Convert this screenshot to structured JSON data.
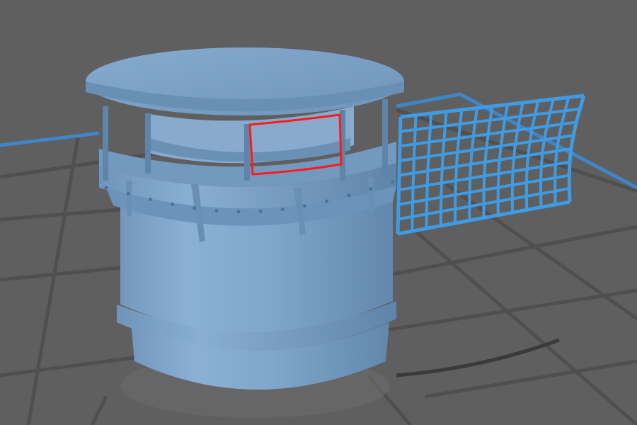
{
  "viewport": {
    "background": "#5f5f5f",
    "grid_color": "#4f4f4f",
    "axis_color": "#3f86c6"
  },
  "model": {
    "body_color": "#7fa6cc",
    "shade_color": "#6c93ba",
    "dark_color": "#5a7fa5",
    "light_color": "#98bde0"
  },
  "screen_grid": {
    "color": "#3f9be3"
  },
  "selection": {
    "color": "#ff1a1a"
  },
  "icons": [
    "rotate-gizmo-none"
  ]
}
